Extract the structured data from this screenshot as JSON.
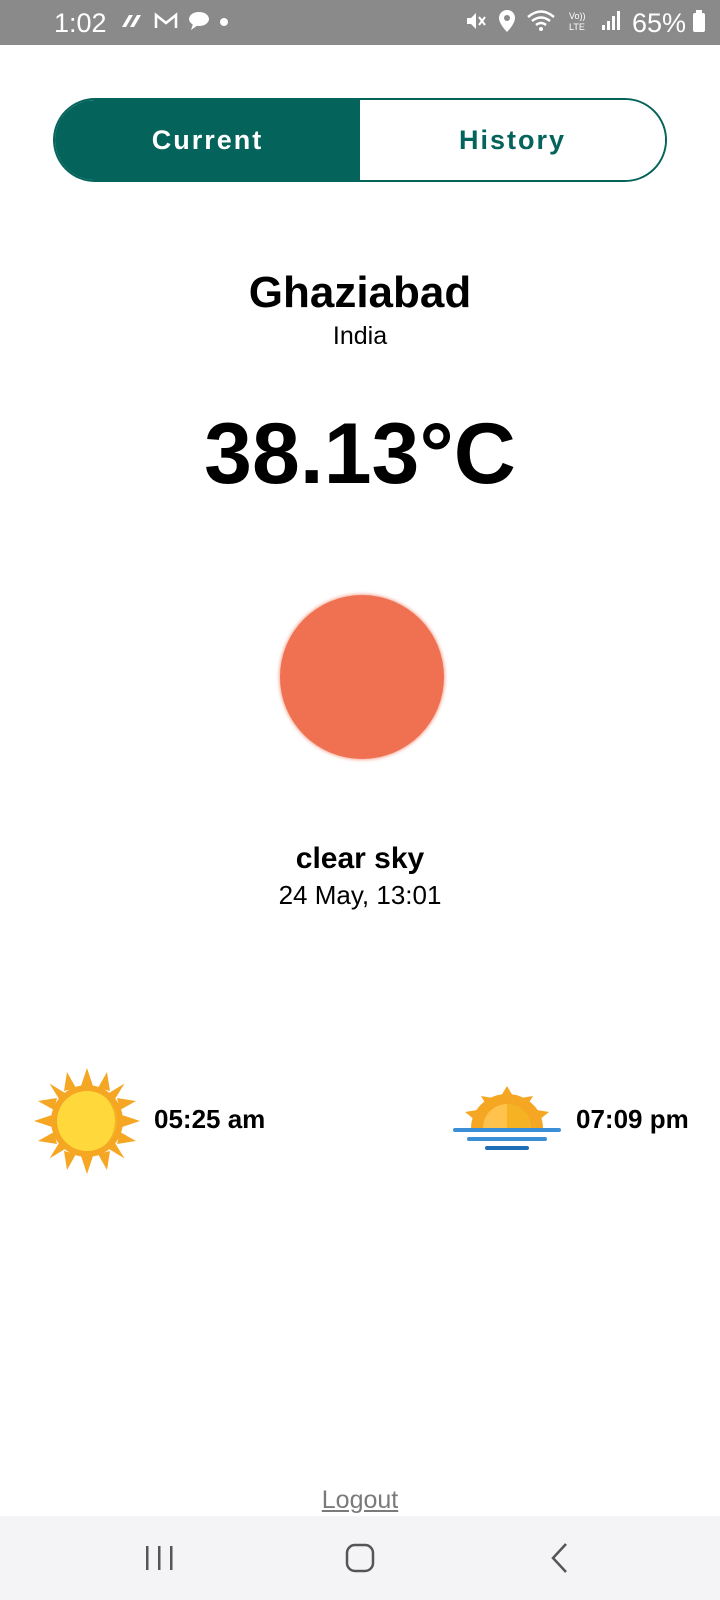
{
  "status_bar": {
    "time": "1:02",
    "battery_percent": "65%",
    "icons": [
      "app-icon",
      "gmail-icon",
      "chat-icon",
      "notification-dot-icon",
      "mute-icon",
      "location-icon",
      "wifi-icon",
      "volte-icon",
      "signal-icon",
      "battery-icon"
    ]
  },
  "tabs": [
    {
      "label": "Current",
      "active": true
    },
    {
      "label": "History",
      "active": false
    }
  ],
  "location": {
    "city": "Ghaziabad",
    "country": "India"
  },
  "weather": {
    "temperature": "38.13°C",
    "condition": "clear sky",
    "datetime": "24 May, 13:01",
    "icon": "clear-sky-sun-icon",
    "icon_color": "#ef7151"
  },
  "sun": {
    "sunrise": "05:25 am",
    "sunset": "07:09 pm"
  },
  "logout_label": "Logout",
  "colors": {
    "accent": "#04635a",
    "status_bar": "#8a8a8a",
    "nav_bar": "#f4f4f6"
  }
}
